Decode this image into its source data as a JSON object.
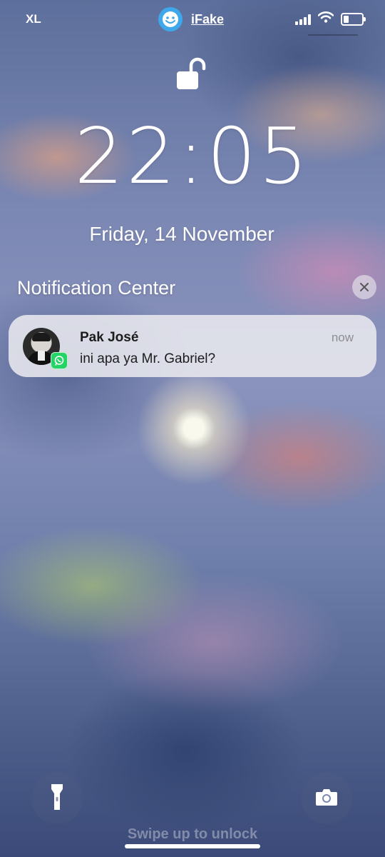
{
  "status_bar": {
    "carrier": "XL",
    "app_name": "iFake",
    "icons": [
      "signal-icon",
      "wifi-icon",
      "battery-icon"
    ],
    "battery_level": 0.3
  },
  "lock_screen": {
    "lock_icon": "unlocked-padlock-icon",
    "time": "22:05",
    "date": "Friday, 14 November"
  },
  "notification_center": {
    "title": "Notification Center",
    "close_icon": "close-icon",
    "notifications": [
      {
        "sender": "Pak José",
        "time": "now",
        "message": "ini apa ya Mr. Gabriel?",
        "app_icon": "whatsapp-icon"
      }
    ]
  },
  "bottom": {
    "flashlight_icon": "flashlight-icon",
    "camera_icon": "camera-icon",
    "swipe_text": "Swipe up to unlock"
  },
  "colors": {
    "notification_bg": "#e8e8ee",
    "whatsapp_green": "#25d366",
    "app_logo_blue": "#3ea8ea"
  }
}
